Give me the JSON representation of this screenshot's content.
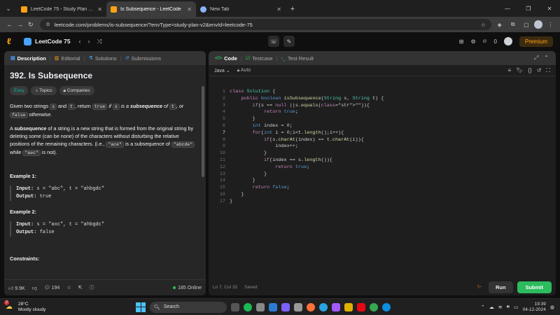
{
  "browser": {
    "tabs": [
      {
        "title": "LeetCode 75 - Study Plan - LeetCode",
        "active": false,
        "color": "#ffa116"
      },
      {
        "title": "Is Subsequence - LeetCode",
        "active": true,
        "color": "#ffa116"
      },
      {
        "title": "New Tab",
        "active": false,
        "color": "#8ab4f8"
      }
    ],
    "url": "leetcode.com/problems/is-subsequence/?envType=study-plan-v2&envId=leetcode-75"
  },
  "lcnav": {
    "plan_title": "LeetCode 75",
    "notif_count": "0",
    "premium_label": "Premium"
  },
  "left": {
    "tabs": [
      {
        "label": "Description",
        "icon": "description-icon",
        "active": true
      },
      {
        "label": "Editorial",
        "icon": "editorial-icon",
        "active": false
      },
      {
        "label": "Solutions",
        "icon": "solutions-icon",
        "active": false
      },
      {
        "label": "Submissions",
        "icon": "submissions-icon",
        "active": false
      }
    ],
    "title": "392. Is Subsequence",
    "badges": {
      "difficulty": "Easy",
      "topics": "Topics",
      "companies": "Companies"
    },
    "desc1": {
      "a": "Given two strings ",
      "s": "s",
      "b": " and ",
      "t": "t",
      "c": ", return ",
      "true": "true",
      "d": " if ",
      "e": "s",
      "f": " is a ",
      "g": "subsequence",
      "h": " of ",
      "i": "t",
      "j": ", or",
      "false": "false",
      "k": " otherwise."
    },
    "desc2": {
      "a": "A ",
      "b": "subsequence",
      "c": " of a string is a new string that is formed from the original string by deleting some (can be none) of the characters without disturbing the relative positions of the remaining characters. (i.e., ",
      "ace": "\"ace\"",
      "d": " is a subsequence of ",
      "abcde": "\"abcde\"",
      "e": " while ",
      "aec": "\"aec\"",
      "f": " is not)."
    },
    "examples": [
      {
        "heading": "Example 1:",
        "input_label": "Input:",
        "input": "s = \"abc\", t = \"ahbgdc\"",
        "output_label": "Output:",
        "output": "true"
      },
      {
        "heading": "Example 2:",
        "input_label": "Input:",
        "input": "s = \"axc\", t = \"ahbgdc\"",
        "output_label": "Output:",
        "output": "false"
      }
    ],
    "constraints_heading": "Constraints:",
    "footer": {
      "likes": "9.9K",
      "comments": "194",
      "online": "185 Online"
    }
  },
  "right": {
    "tabs": [
      {
        "label": "Code",
        "icon": "code-icon",
        "active": true
      },
      {
        "label": "Testcase",
        "icon": "testcase-icon",
        "active": false
      },
      {
        "label": "Test Result",
        "icon": "test-result-icon",
        "active": false
      }
    ],
    "language": "Java",
    "mode": "Auto",
    "status": {
      "cursor": "Ln 7, Col 33",
      "saved": "Saved"
    },
    "run_label": "Run",
    "submit_label": "Submit"
  },
  "code_lines": [
    "class Solution {",
    "    public boolean isSubsequence(String s, String t) {",
    "        if(s == null ||s.equals(\"\")){",
    "            return true;",
    "        }",
    "        int index = 0;",
    "        for(int i = 0;i<t.length();i++){",
    "            if(s.charAt(index) == t.charAt(i)){",
    "                index++;",
    "            }",
    "            if(index == s.length()){",
    "                return true;",
    "            }",
    "        }",
    "        return false;",
    "    }",
    "}"
  ],
  "current_line": 7,
  "taskbar": {
    "weather_temp": "28°C",
    "weather_desc": "Mostly cloudy",
    "weather_badge": "2",
    "search_label": "Search",
    "time": "19:39",
    "date": "04-12-2024"
  }
}
